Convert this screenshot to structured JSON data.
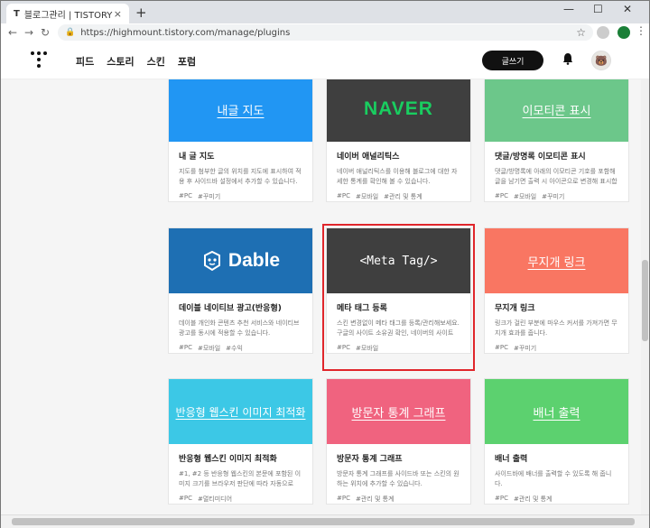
{
  "browser": {
    "tab_title": "블로그관리 | TISTORY",
    "tab_favicon": "T",
    "close_tab": "×",
    "new_tab": "+",
    "url": "https://highmount.tistory.com/manage/plugins",
    "controls": {
      "minimize": "—",
      "maximize": "☐",
      "close": "✕"
    }
  },
  "header": {
    "nav": [
      "피드",
      "스토리",
      "스킨",
      "포럼"
    ],
    "write_button": "글쓰기"
  },
  "cards": [
    {
      "thumb_label": "내글 지도",
      "name": "내 글 지도",
      "desc": "지도를 첨부한 글의 위치를 지도에 표시하여 적용 후 사이드바 설정에서 추가할 수 있습니다.",
      "tags": [
        "#PC",
        "#꾸미기"
      ]
    },
    {
      "thumb_label": "NAVER",
      "name": "네이버 애널리틱스",
      "desc": "네이버 애널리틱스를 이용해 블로그에 대한 자세한 통계를 확인해 볼 수 있습니다.",
      "tags": [
        "#PC",
        "#모바일",
        "#관리 및 통계"
      ]
    },
    {
      "thumb_label": "이모티콘 표시",
      "name": "댓글/방명록 이모티콘 표시",
      "desc": "댓글/방명록에 아래의 이모티콘 기호를 포함해 글을 남기면 출력 시 아이콘으로 변경해 표시합니다.",
      "tags": [
        "#PC",
        "#모바일",
        "#꾸미기"
      ]
    },
    {
      "thumb_label": "Dable",
      "name": "데이블 네이티브 광고(반응형)",
      "desc": "데이블 개인화 콘텐츠 추천 서비스와 네이티브 광고를 동시에 적용할 수 있습니다.",
      "tags": [
        "#PC",
        "#모바일",
        "#수익"
      ]
    },
    {
      "thumb_label": "<Meta Tag/>",
      "name": "메타 태그 등록",
      "desc": "스킨 변경없이 메타 태그를 등록/관리해보세요. 구글의 사이트 소유권 확인, 네이버의 사이트 …",
      "tags": [
        "#PC",
        "#모바일"
      ]
    },
    {
      "thumb_label": "무지개 링크",
      "name": "무지개 링크",
      "desc": "링크가 걸린 부분에 마우스 커서를 가져가면 무지개 효과를 줍니다.",
      "tags": [
        "#PC",
        "#꾸미기"
      ]
    },
    {
      "thumb_label": "반응형 웹스킨 이미지 최적화",
      "name": "반응형 웹스킨 이미지 최적화",
      "desc": "#1, #2 등 반응형 웹스킨의 본문에 포함된 이미지 크기를 브라우저 판단에 따라 자동으로 조…",
      "tags": [
        "#PC",
        "#멀티미디어"
      ]
    },
    {
      "thumb_label": "방문자 통계 그래프",
      "name": "방문자 통계 그래프",
      "desc": "방문자 통계 그래프를 사이드바 또는 스킨의 원하는 위치에 추가할 수 있습니다.",
      "tags": [
        "#PC",
        "#관리 및 통계"
      ]
    },
    {
      "thumb_label": "배너 출력",
      "name": "배너 출력",
      "desc": "사이드바에 배너를 출력할 수 있도록 해 줍니다.",
      "tags": [
        "#PC",
        "#관리 및 통계"
      ]
    }
  ],
  "colors": {
    "blue": "#2196f3",
    "naver_bg": "#3f3f3f",
    "naver_green": "#19ce60",
    "green": "#6cc78a",
    "dable_bg": "#1e6fb3",
    "coral": "#f97662",
    "cyan": "#3cc8e6",
    "pink": "#f0637f",
    "light_green": "#5cd16f",
    "highlight": "#e0262b"
  }
}
